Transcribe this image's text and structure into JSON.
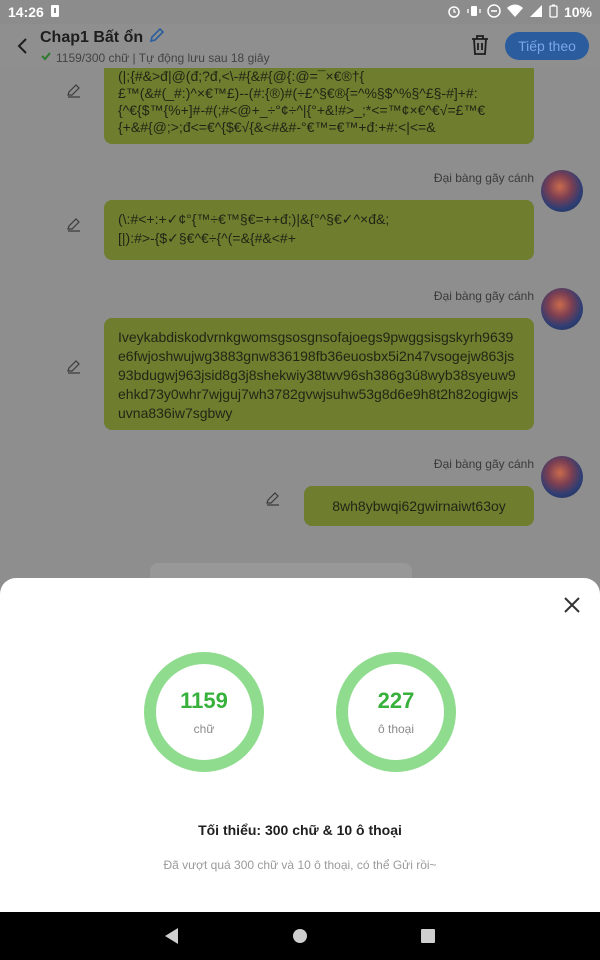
{
  "status_bar": {
    "time": "14:26",
    "battery_percent": "10%",
    "icons": [
      "notification-icon",
      "alarm-icon",
      "vibrate-icon",
      "dnd-icon",
      "wifi-icon",
      "signal-icon",
      "battery-icon"
    ]
  },
  "header": {
    "title": "Chap1 Bất ổn",
    "subtitle": "1159/300 chữ | Tự động lưu sau 18 giây",
    "next_label": "Tiếp theo",
    "accent_color": "#2b5c9e"
  },
  "messages": [
    {
      "author": "",
      "text": "(|;{#&>đ|@(đ;?đ,<\\-#{&#{@{:@=¯×€®†{\n£™(&#(_#:)^×€™£)--(#:{®)#(÷£^§€®{=^%§$^%§^£§-#]+#:\n{^€{$™{%+]#-#(;#<@+_÷°¢÷^|{°+&!#>_;*<=™¢×€^€√=£™€\n{+&#{@;>;đ<=€^{$€√{&<#&#-°€™=€™+đ:+#:<|<=&"
    },
    {
      "author": "Đại bàng gãy cánh",
      "text": "(\\:#<+:+✓¢°{™÷€™§€=++đ;)|&{°^§€✓^×đ&;\n[|):#>-{$✓§€^€÷{^(=&{#&<#+"
    },
    {
      "author": "Đại bàng gãy cánh",
      "text": "Iveykabdiskodvrnkgwomsgsosgnsofajoegs9pwggsisgskyrh9639e6fwjoshwujwg3883gnw836198fb36euosbx5i2n47vsogejw863js93bdugwj963jsid8g3j8shekwiy38twv96sh386g3ú8wyb38syeuw9ehkd73y0whr7wjguj7wh3782gvwjsuhw53g8d6e9h8t2h82ogigwjsuvna836iw7sgbwy"
    },
    {
      "author": "Đại bàng gãy cánh",
      "text": "8wh8ybwqi62gwirnaiwt63oy"
    }
  ],
  "stats": {
    "words_value": "1159",
    "words_label": "chữ",
    "dialogs_value": "227",
    "dialogs_label": "ô thoại",
    "ring_color": "#8fdc8f",
    "number_color": "#37b13c"
  },
  "sheet": {
    "minimum_text": "Tối thiểu: 300 chữ & 10 ô thoại",
    "note_text": "Đã vượt quá 300 chữ và 10 ô thoại, có thể Gửi rồi~"
  },
  "nav": {
    "icons": [
      "back-triangle-icon",
      "home-circle-icon",
      "recents-square-icon"
    ]
  }
}
